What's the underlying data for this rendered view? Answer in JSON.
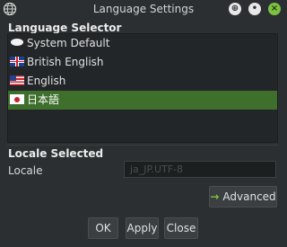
{
  "window": {
    "title": "Language Settings",
    "controls": {
      "pin": "⊕",
      "minimize": "•",
      "close": "×"
    }
  },
  "language_selector": {
    "heading": "Language Selector",
    "items": [
      {
        "label": "System Default",
        "icon": "speech-bubble-icon",
        "selected": false
      },
      {
        "label": "British English",
        "icon": "uk-flag-icon",
        "selected": false
      },
      {
        "label": "English",
        "icon": "us-flag-icon",
        "selected": false
      },
      {
        "label": "日本語",
        "icon": "japan-flag-icon",
        "selected": true
      }
    ]
  },
  "locale_selected": {
    "heading": "Locale Selected",
    "label": "Locale",
    "value": "ja_JP.UTF-8"
  },
  "buttons": {
    "advanced": "Advanced",
    "ok": "OK",
    "apply": "Apply",
    "close": "Close"
  },
  "colors": {
    "background": "#2b2f31",
    "selection": "#3f6f2c",
    "accent": "#7cc243"
  }
}
